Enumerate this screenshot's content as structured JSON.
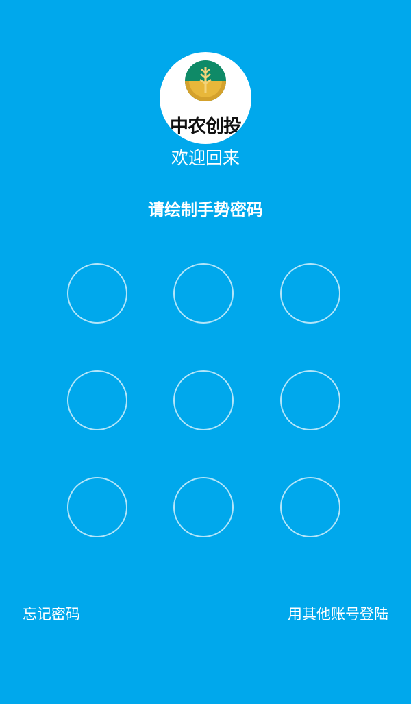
{
  "app": {
    "logo_text": "中农创投",
    "colors": {
      "background": "#00a8ec",
      "logo_green": "#0f8a67",
      "logo_gold": "#d4a12c"
    }
  },
  "header": {
    "welcome_text": "欢迎回来"
  },
  "gesture": {
    "prompt": "请绘制手势密码",
    "dots": [
      1,
      2,
      3,
      4,
      5,
      6,
      7,
      8,
      9
    ]
  },
  "footer": {
    "forgot_password_label": "忘记密码",
    "other_account_label": "用其他账号登陆"
  }
}
